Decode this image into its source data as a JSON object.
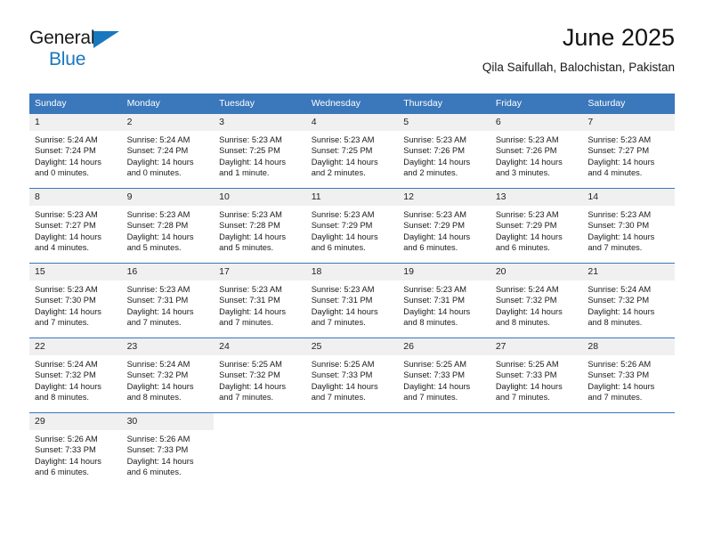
{
  "brand": {
    "name_part1": "General",
    "name_part2": "Blue",
    "accent_color": "#1878be"
  },
  "header": {
    "title": "June 2025",
    "location": "Qila Saifullah, Balochistan, Pakistan"
  },
  "theme": {
    "header_bg": "#3a77bb",
    "daynum_bg": "#f0f0f0",
    "row_border": "#3a77bb"
  },
  "calendar": {
    "weekday_headers": [
      "Sunday",
      "Monday",
      "Tuesday",
      "Wednesday",
      "Thursday",
      "Friday",
      "Saturday"
    ],
    "weeks": [
      [
        {
          "day": "1",
          "sunrise": "Sunrise: 5:24 AM",
          "sunset": "Sunset: 7:24 PM",
          "daylight1": "Daylight: 14 hours",
          "daylight2": "and 0 minutes."
        },
        {
          "day": "2",
          "sunrise": "Sunrise: 5:24 AM",
          "sunset": "Sunset: 7:24 PM",
          "daylight1": "Daylight: 14 hours",
          "daylight2": "and 0 minutes."
        },
        {
          "day": "3",
          "sunrise": "Sunrise: 5:23 AM",
          "sunset": "Sunset: 7:25 PM",
          "daylight1": "Daylight: 14 hours",
          "daylight2": "and 1 minute."
        },
        {
          "day": "4",
          "sunrise": "Sunrise: 5:23 AM",
          "sunset": "Sunset: 7:25 PM",
          "daylight1": "Daylight: 14 hours",
          "daylight2": "and 2 minutes."
        },
        {
          "day": "5",
          "sunrise": "Sunrise: 5:23 AM",
          "sunset": "Sunset: 7:26 PM",
          "daylight1": "Daylight: 14 hours",
          "daylight2": "and 2 minutes."
        },
        {
          "day": "6",
          "sunrise": "Sunrise: 5:23 AM",
          "sunset": "Sunset: 7:26 PM",
          "daylight1": "Daylight: 14 hours",
          "daylight2": "and 3 minutes."
        },
        {
          "day": "7",
          "sunrise": "Sunrise: 5:23 AM",
          "sunset": "Sunset: 7:27 PM",
          "daylight1": "Daylight: 14 hours",
          "daylight2": "and 4 minutes."
        }
      ],
      [
        {
          "day": "8",
          "sunrise": "Sunrise: 5:23 AM",
          "sunset": "Sunset: 7:27 PM",
          "daylight1": "Daylight: 14 hours",
          "daylight2": "and 4 minutes."
        },
        {
          "day": "9",
          "sunrise": "Sunrise: 5:23 AM",
          "sunset": "Sunset: 7:28 PM",
          "daylight1": "Daylight: 14 hours",
          "daylight2": "and 5 minutes."
        },
        {
          "day": "10",
          "sunrise": "Sunrise: 5:23 AM",
          "sunset": "Sunset: 7:28 PM",
          "daylight1": "Daylight: 14 hours",
          "daylight2": "and 5 minutes."
        },
        {
          "day": "11",
          "sunrise": "Sunrise: 5:23 AM",
          "sunset": "Sunset: 7:29 PM",
          "daylight1": "Daylight: 14 hours",
          "daylight2": "and 6 minutes."
        },
        {
          "day": "12",
          "sunrise": "Sunrise: 5:23 AM",
          "sunset": "Sunset: 7:29 PM",
          "daylight1": "Daylight: 14 hours",
          "daylight2": "and 6 minutes."
        },
        {
          "day": "13",
          "sunrise": "Sunrise: 5:23 AM",
          "sunset": "Sunset: 7:29 PM",
          "daylight1": "Daylight: 14 hours",
          "daylight2": "and 6 minutes."
        },
        {
          "day": "14",
          "sunrise": "Sunrise: 5:23 AM",
          "sunset": "Sunset: 7:30 PM",
          "daylight1": "Daylight: 14 hours",
          "daylight2": "and 7 minutes."
        }
      ],
      [
        {
          "day": "15",
          "sunrise": "Sunrise: 5:23 AM",
          "sunset": "Sunset: 7:30 PM",
          "daylight1": "Daylight: 14 hours",
          "daylight2": "and 7 minutes."
        },
        {
          "day": "16",
          "sunrise": "Sunrise: 5:23 AM",
          "sunset": "Sunset: 7:31 PM",
          "daylight1": "Daylight: 14 hours",
          "daylight2": "and 7 minutes."
        },
        {
          "day": "17",
          "sunrise": "Sunrise: 5:23 AM",
          "sunset": "Sunset: 7:31 PM",
          "daylight1": "Daylight: 14 hours",
          "daylight2": "and 7 minutes."
        },
        {
          "day": "18",
          "sunrise": "Sunrise: 5:23 AM",
          "sunset": "Sunset: 7:31 PM",
          "daylight1": "Daylight: 14 hours",
          "daylight2": "and 7 minutes."
        },
        {
          "day": "19",
          "sunrise": "Sunrise: 5:23 AM",
          "sunset": "Sunset: 7:31 PM",
          "daylight1": "Daylight: 14 hours",
          "daylight2": "and 8 minutes."
        },
        {
          "day": "20",
          "sunrise": "Sunrise: 5:24 AM",
          "sunset": "Sunset: 7:32 PM",
          "daylight1": "Daylight: 14 hours",
          "daylight2": "and 8 minutes."
        },
        {
          "day": "21",
          "sunrise": "Sunrise: 5:24 AM",
          "sunset": "Sunset: 7:32 PM",
          "daylight1": "Daylight: 14 hours",
          "daylight2": "and 8 minutes."
        }
      ],
      [
        {
          "day": "22",
          "sunrise": "Sunrise: 5:24 AM",
          "sunset": "Sunset: 7:32 PM",
          "daylight1": "Daylight: 14 hours",
          "daylight2": "and 8 minutes."
        },
        {
          "day": "23",
          "sunrise": "Sunrise: 5:24 AM",
          "sunset": "Sunset: 7:32 PM",
          "daylight1": "Daylight: 14 hours",
          "daylight2": "and 8 minutes."
        },
        {
          "day": "24",
          "sunrise": "Sunrise: 5:25 AM",
          "sunset": "Sunset: 7:32 PM",
          "daylight1": "Daylight: 14 hours",
          "daylight2": "and 7 minutes."
        },
        {
          "day": "25",
          "sunrise": "Sunrise: 5:25 AM",
          "sunset": "Sunset: 7:33 PM",
          "daylight1": "Daylight: 14 hours",
          "daylight2": "and 7 minutes."
        },
        {
          "day": "26",
          "sunrise": "Sunrise: 5:25 AM",
          "sunset": "Sunset: 7:33 PM",
          "daylight1": "Daylight: 14 hours",
          "daylight2": "and 7 minutes."
        },
        {
          "day": "27",
          "sunrise": "Sunrise: 5:25 AM",
          "sunset": "Sunset: 7:33 PM",
          "daylight1": "Daylight: 14 hours",
          "daylight2": "and 7 minutes."
        },
        {
          "day": "28",
          "sunrise": "Sunrise: 5:26 AM",
          "sunset": "Sunset: 7:33 PM",
          "daylight1": "Daylight: 14 hours",
          "daylight2": "and 7 minutes."
        }
      ],
      [
        {
          "day": "29",
          "sunrise": "Sunrise: 5:26 AM",
          "sunset": "Sunset: 7:33 PM",
          "daylight1": "Daylight: 14 hours",
          "daylight2": "and 6 minutes."
        },
        {
          "day": "30",
          "sunrise": "Sunrise: 5:26 AM",
          "sunset": "Sunset: 7:33 PM",
          "daylight1": "Daylight: 14 hours",
          "daylight2": "and 6 minutes."
        },
        {
          "day": "",
          "sunrise": "",
          "sunset": "",
          "daylight1": "",
          "daylight2": ""
        },
        {
          "day": "",
          "sunrise": "",
          "sunset": "",
          "daylight1": "",
          "daylight2": ""
        },
        {
          "day": "",
          "sunrise": "",
          "sunset": "",
          "daylight1": "",
          "daylight2": ""
        },
        {
          "day": "",
          "sunrise": "",
          "sunset": "",
          "daylight1": "",
          "daylight2": ""
        },
        {
          "day": "",
          "sunrise": "",
          "sunset": "",
          "daylight1": "",
          "daylight2": ""
        }
      ]
    ]
  }
}
